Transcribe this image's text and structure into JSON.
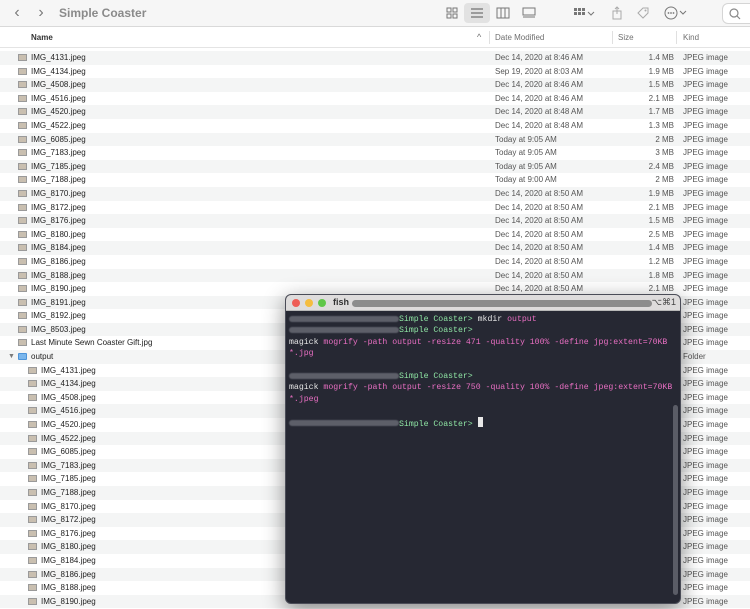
{
  "window": {
    "title": "Simple Coaster"
  },
  "toolbar": {
    "back": "‹",
    "forward": "›"
  },
  "header": {
    "name": "Name",
    "date": "Date Modified",
    "size": "Size",
    "kind": "Kind"
  },
  "files": [
    {
      "name": "IMG_4131.jpeg",
      "date": "Dec 14, 2020 at 8:46 AM",
      "size": "1.4 MB",
      "kind": "JPEG image"
    },
    {
      "name": "IMG_4134.jpeg",
      "date": "Sep 19, 2020 at 8:03 AM",
      "size": "1.9 MB",
      "kind": "JPEG image"
    },
    {
      "name": "IMG_4508.jpeg",
      "date": "Dec 14, 2020 at 8:46 AM",
      "size": "1.5 MB",
      "kind": "JPEG image"
    },
    {
      "name": "IMG_4516.jpeg",
      "date": "Dec 14, 2020 at 8:46 AM",
      "size": "2.1 MB",
      "kind": "JPEG image"
    },
    {
      "name": "IMG_4520.jpeg",
      "date": "Dec 14, 2020 at 8:48 AM",
      "size": "1.7 MB",
      "kind": "JPEG image"
    },
    {
      "name": "IMG_4522.jpeg",
      "date": "Dec 14, 2020 at 8:48 AM",
      "size": "1.3 MB",
      "kind": "JPEG image"
    },
    {
      "name": "IMG_6085.jpeg",
      "date": "Today at 9:05 AM",
      "size": "2 MB",
      "kind": "JPEG image"
    },
    {
      "name": "IMG_7183.jpeg",
      "date": "Today at 9:05 AM",
      "size": "3 MB",
      "kind": "JPEG image"
    },
    {
      "name": "IMG_7185.jpeg",
      "date": "Today at 9:05 AM",
      "size": "2.4 MB",
      "kind": "JPEG image"
    },
    {
      "name": "IMG_7188.jpeg",
      "date": "Today at 9:00 AM",
      "size": "2 MB",
      "kind": "JPEG image"
    },
    {
      "name": "IMG_8170.jpeg",
      "date": "Dec 14, 2020 at 8:50 AM",
      "size": "1.9 MB",
      "kind": "JPEG image"
    },
    {
      "name": "IMG_8172.jpeg",
      "date": "Dec 14, 2020 at 8:50 AM",
      "size": "2.1 MB",
      "kind": "JPEG image"
    },
    {
      "name": "IMG_8176.jpeg",
      "date": "Dec 14, 2020 at 8:50 AM",
      "size": "1.5 MB",
      "kind": "JPEG image"
    },
    {
      "name": "IMG_8180.jpeg",
      "date": "Dec 14, 2020 at 8:50 AM",
      "size": "2.5 MB",
      "kind": "JPEG image"
    },
    {
      "name": "IMG_8184.jpeg",
      "date": "Dec 14, 2020 at 8:50 AM",
      "size": "1.4 MB",
      "kind": "JPEG image"
    },
    {
      "name": "IMG_8186.jpeg",
      "date": "Dec 14, 2020 at 8:50 AM",
      "size": "1.2 MB",
      "kind": "JPEG image"
    },
    {
      "name": "IMG_8188.jpeg",
      "date": "Dec 14, 2020 at 8:50 AM",
      "size": "1.8 MB",
      "kind": "JPEG image"
    },
    {
      "name": "IMG_8190.jpeg",
      "date": "Dec 14, 2020 at 8:50 AM",
      "size": "2.1 MB",
      "kind": "JPEG image"
    },
    {
      "name": "IMG_8191.jpeg",
      "date": "",
      "size": "",
      "kind": "JPEG image"
    },
    {
      "name": "IMG_8192.jpeg",
      "date": "",
      "size": "",
      "kind": "JPEG image"
    },
    {
      "name": "IMG_8503.jpeg",
      "date": "",
      "size": "",
      "kind": "JPEG image"
    },
    {
      "name": "Last Minute Sewn Coaster Gift.jpg",
      "date": "",
      "size": "",
      "kind": "JPEG image"
    },
    {
      "name": "output",
      "date": "",
      "size": "",
      "kind": "Folder",
      "folder": true
    },
    {
      "name": "IMG_4131.jpeg",
      "date": "",
      "size": "",
      "kind": "JPEG image",
      "nested": true
    },
    {
      "name": "IMG_4134.jpeg",
      "date": "",
      "size": "",
      "kind": "JPEG image",
      "nested": true
    },
    {
      "name": "IMG_4508.jpeg",
      "date": "",
      "size": "",
      "kind": "JPEG image",
      "nested": true
    },
    {
      "name": "IMG_4516.jpeg",
      "date": "",
      "size": "",
      "kind": "JPEG image",
      "nested": true
    },
    {
      "name": "IMG_4520.jpeg",
      "date": "",
      "size": "",
      "kind": "JPEG image",
      "nested": true
    },
    {
      "name": "IMG_4522.jpeg",
      "date": "",
      "size": "",
      "kind": "JPEG image",
      "nested": true
    },
    {
      "name": "IMG_6085.jpeg",
      "date": "",
      "size": "",
      "kind": "JPEG image",
      "nested": true
    },
    {
      "name": "IMG_7183.jpeg",
      "date": "",
      "size": "",
      "kind": "JPEG image",
      "nested": true
    },
    {
      "name": "IMG_7185.jpeg",
      "date": "",
      "size": "",
      "kind": "JPEG image",
      "nested": true
    },
    {
      "name": "IMG_7188.jpeg",
      "date": "",
      "size": "",
      "kind": "JPEG image",
      "nested": true
    },
    {
      "name": "IMG_8170.jpeg",
      "date": "",
      "size": "",
      "kind": "JPEG image",
      "nested": true
    },
    {
      "name": "IMG_8172.jpeg",
      "date": "",
      "size": "",
      "kind": "JPEG image",
      "nested": true
    },
    {
      "name": "IMG_8176.jpeg",
      "date": "",
      "size": "",
      "kind": "JPEG image",
      "nested": true
    },
    {
      "name": "IMG_8180.jpeg",
      "date": "",
      "size": "",
      "kind": "JPEG image",
      "nested": true
    },
    {
      "name": "IMG_8184.jpeg",
      "date": "",
      "size": "",
      "kind": "JPEG image",
      "nested": true
    },
    {
      "name": "IMG_8186.jpeg",
      "date": "",
      "size": "",
      "kind": "JPEG image",
      "nested": true
    },
    {
      "name": "IMG_8188.jpeg",
      "date": "",
      "size": "",
      "kind": "JPEG image",
      "nested": true
    },
    {
      "name": "IMG_8190.jpeg",
      "date": "",
      "size": "",
      "kind": "JPEG image",
      "nested": true
    }
  ],
  "terminal": {
    "title": "fish",
    "shortcut": "⌥⌘1",
    "lines": [
      {
        "prompt": "Simple Coaster>",
        "cmd": "mkdir",
        "args": "output"
      },
      {
        "prompt": "Simple Coaster>",
        "cmd": "",
        "args": ""
      },
      {
        "prompt": "",
        "cmd": "magick",
        "args": "mogrify -path output -resize 471 -quality 100% -define jpg:extent=70KB *.jpg"
      },
      {
        "prompt": "",
        "cmd": "",
        "args": ""
      },
      {
        "prompt": "Simple Coaster>",
        "cmd": "",
        "args": ""
      },
      {
        "prompt": "",
        "cmd": "magick",
        "args": "mogrify -path output -resize 750 -quality 100% -define jpeg:extent=70KB *.jpeg"
      },
      {
        "prompt": "",
        "cmd": "",
        "args": ""
      },
      {
        "prompt": "Simple Coaster>",
        "cmd": "",
        "args": "",
        "cursor": true
      }
    ]
  },
  "colors": {
    "accent": "#3478f6",
    "terminal_bg": "#262833",
    "prompt_green": "#8ee3a3",
    "arg_pink": "#e96fc3",
    "folder_blue": "#7ab6ec"
  }
}
